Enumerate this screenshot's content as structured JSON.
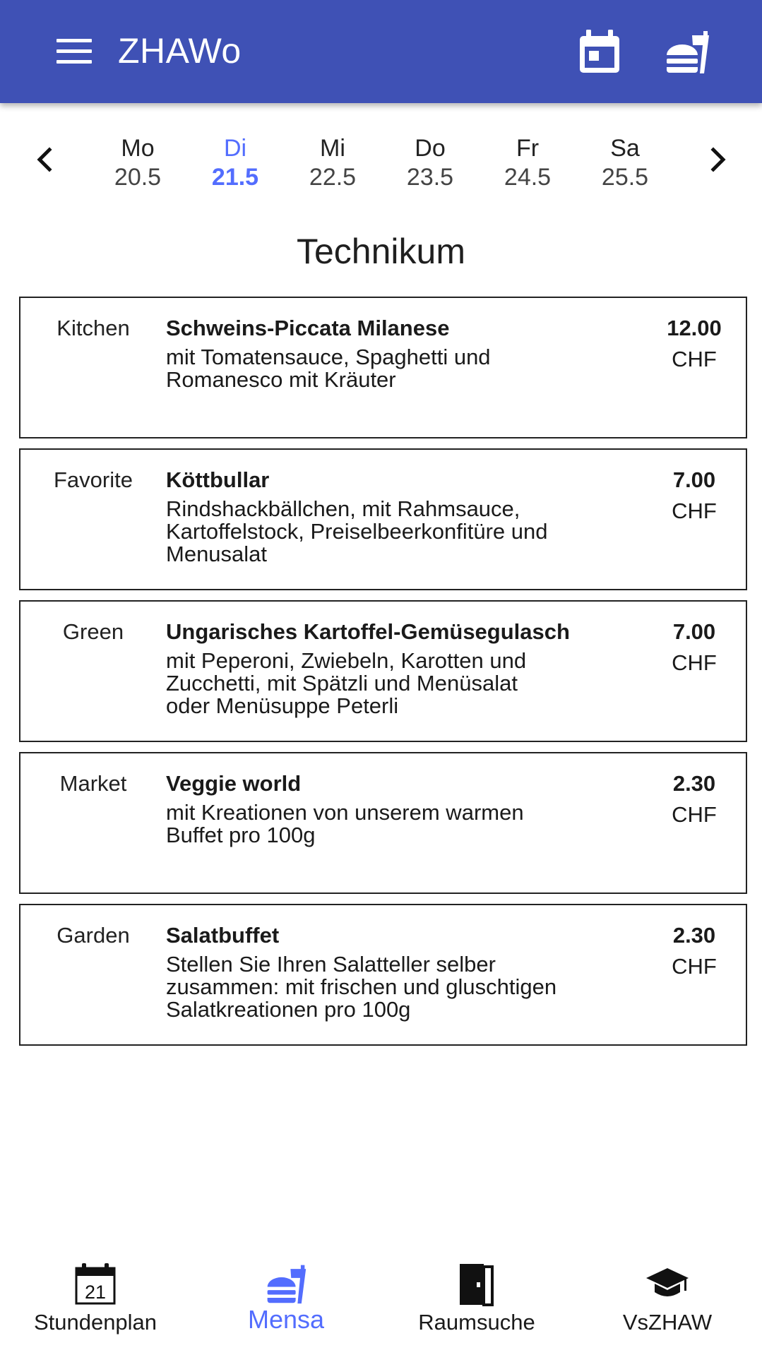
{
  "theme": {
    "primary": "#3f51b5",
    "accent": "#536dfe"
  },
  "appbar": {
    "title": "ZHAWo",
    "menu_icon": "hamburger-menu-icon",
    "actions": [
      {
        "icon": "calendar-today-icon"
      },
      {
        "icon": "fastfood-icon"
      }
    ]
  },
  "day_selector": {
    "prev_icon": "chevron-left-icon",
    "next_icon": "chevron-right-icon",
    "selected_index": 1,
    "days": [
      {
        "name": "Mo",
        "date": "20.5"
      },
      {
        "name": "Di",
        "date": "21.5"
      },
      {
        "name": "Mi",
        "date": "22.5"
      },
      {
        "name": "Do",
        "date": "23.5"
      },
      {
        "name": "Fr",
        "date": "24.5"
      },
      {
        "name": "Sa",
        "date": "25.5"
      }
    ]
  },
  "location": "Technikum",
  "menus": [
    {
      "category": "Kitchen",
      "dish": "Schweins-Piccata Milanese",
      "description": [
        "mit Tomatensauce, Spaghetti und",
        "Romanesco mit Kräuter"
      ],
      "price": "12.00",
      "currency": "CHF"
    },
    {
      "category": "Favorite",
      "dish": "Köttbullar",
      "description": [
        "Rindshackbällchen, mit Rahmsauce,",
        "Kartoffelstock, Preiselbeerkonfitüre und",
        "Menusalat"
      ],
      "price": "7.00",
      "currency": "CHF"
    },
    {
      "category": "Green",
      "dish": "Ungarisches Kartoffel-Gemüsegulasch",
      "description": [
        "mit Peperoni, Zwiebeln, Karotten und",
        "Zucchetti, mit Spätzli und Menüsalat",
        "oder Menüsuppe Peterli"
      ],
      "price": "7.00",
      "currency": "CHF"
    },
    {
      "category": "Market",
      "dish": "Veggie world",
      "description": [
        "mit Kreationen von unserem warmen",
        "Buffet pro 100g"
      ],
      "price": "2.30",
      "currency": "CHF"
    },
    {
      "category": "Garden",
      "dish": "Salatbuffet",
      "description": [
        "Stellen Sie Ihren Salatteller selber",
        "zusammen: mit frischen und gluschtigen",
        "Salatkreationen pro 100g"
      ],
      "price": "2.30",
      "currency": "CHF"
    }
  ],
  "bottom_nav": {
    "active_index": 1,
    "items": [
      {
        "label": "Stundenplan",
        "icon": "calendar-icon",
        "icon_text": "21"
      },
      {
        "label": "Mensa",
        "icon": "fastfood-icon"
      },
      {
        "label": "Raumsuche",
        "icon": "door-icon"
      },
      {
        "label": "VsZHAW",
        "icon": "graduation-cap-icon"
      }
    ]
  }
}
